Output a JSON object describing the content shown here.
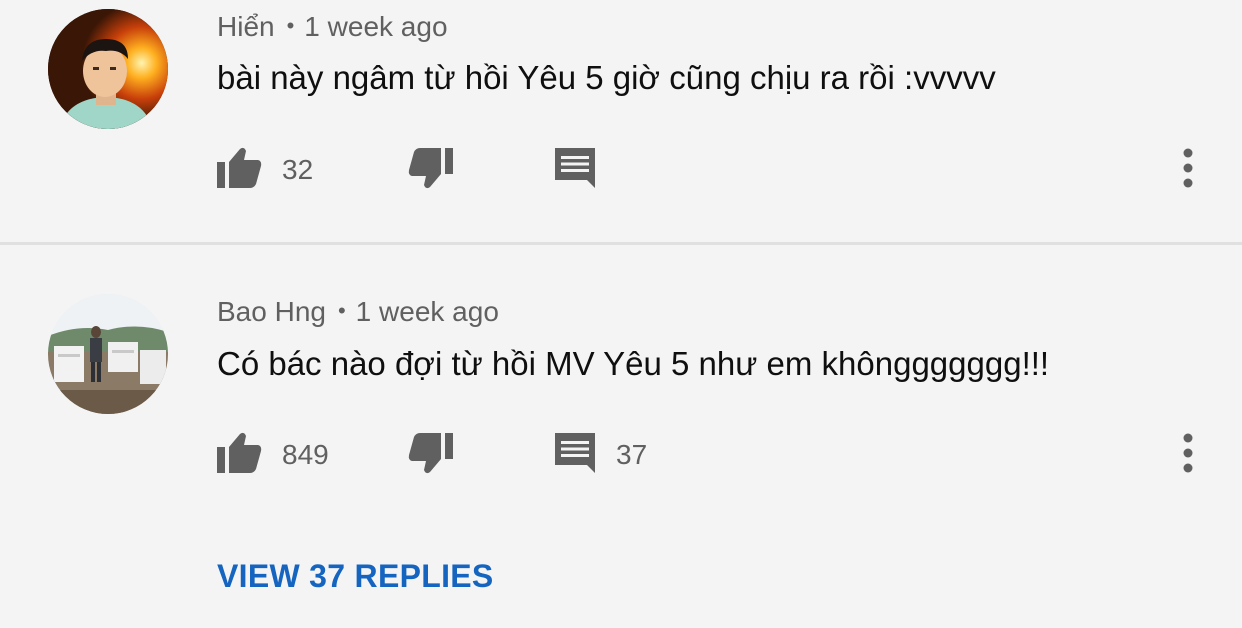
{
  "colors": {
    "background": "#f4f4f4",
    "meta_text": "#606060",
    "comment_text": "#0f0f0f",
    "icon": "#606060",
    "link": "#1565c0",
    "divider": "#e0e0e0"
  },
  "comments": [
    {
      "author": "Hiển",
      "separator": "•",
      "time": "1 week ago",
      "text": "bài này ngâm từ hồi Yêu 5 giờ cũng chịu ra rồi :vvvvv",
      "likes": "32",
      "replies": "",
      "icons": [
        "thumbs-up-icon",
        "thumbs-down-icon",
        "reply-icon",
        "more-vert-icon"
      ]
    },
    {
      "author": "Bao Hng",
      "separator": "•",
      "time": "1 week ago",
      "text": "Có bác nào đợi từ hồi MV Yêu 5 như em khônggggggg!!!",
      "likes": "849",
      "replies": "37",
      "view_replies_label": "VIEW 37 REPLIES",
      "icons": [
        "thumbs-up-icon",
        "thumbs-down-icon",
        "reply-icon",
        "more-vert-icon"
      ]
    }
  ]
}
